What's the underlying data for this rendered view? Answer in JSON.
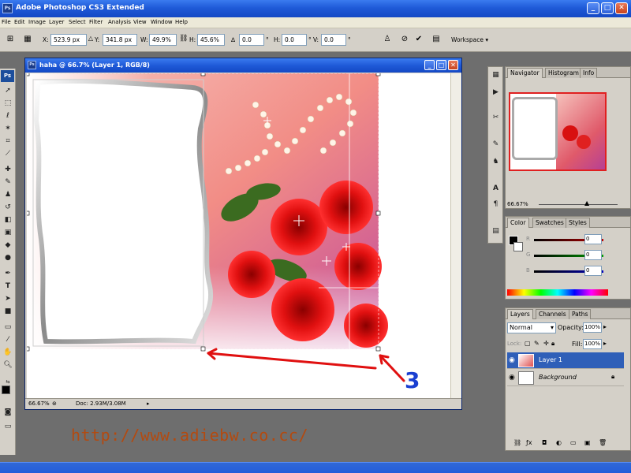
{
  "app": {
    "title": "Adobe Photoshop CS3 Extended",
    "icon_label": "Ps"
  },
  "window_buttons": [
    "_",
    "□",
    "✕"
  ],
  "menu": [
    "File",
    "Edit",
    "Image",
    "Layer",
    "Select",
    "Filter",
    "Analysis",
    "View",
    "Window",
    "Help"
  ],
  "options_bar": {
    "x_label": "X:",
    "x_value": "523.9 px",
    "y_label": "Y:",
    "y_value": "341.8 px",
    "w_label": "W:",
    "w_value": "49.9%",
    "h_label": "H:",
    "h_value": "45.6%",
    "rot_label": "∆",
    "rot_value": "0.0",
    "hskew_label": "H:",
    "hskew_value": "0.0",
    "vskew_label": "V:",
    "vskew_value": "0.0",
    "degree": "°",
    "workspace_label": "Workspace ▾"
  },
  "document": {
    "title": "haha @ 66.7% (Layer 1, RGB/8)",
    "zoom": "66.67%",
    "doc_info": "Doc: 2.93M/3.08M"
  },
  "navigator_panel": {
    "tabs": [
      "Navigator",
      "Histogram",
      "Info"
    ],
    "zoom": "66.67%"
  },
  "color_panel": {
    "tabs": [
      "Color",
      "Swatches",
      "Styles"
    ],
    "channels": [
      {
        "label": "R",
        "value": "0",
        "color": "#c00000"
      },
      {
        "label": "G",
        "value": "0",
        "color": "#00a000"
      },
      {
        "label": "B",
        "value": "0",
        "color": "#0000c0"
      }
    ]
  },
  "layers_panel": {
    "tabs": [
      "Layers",
      "Channels",
      "Paths"
    ],
    "blend_mode": "Normal",
    "opacity_label": "Opacity:",
    "opacity_value": "100%",
    "lock_label": "Lock:",
    "fill_label": "Fill:",
    "fill_value": "100%",
    "layers": [
      {
        "name": "Layer 1",
        "selected": true
      },
      {
        "name": "Background",
        "selected": false
      }
    ]
  },
  "annotation": {
    "number": "3",
    "url": "http://www.adiebw.co.cc/",
    "arrow_color": "#e01010"
  },
  "colors": {
    "accent": "#2f6ad8",
    "selection": "#2f5fb8"
  }
}
